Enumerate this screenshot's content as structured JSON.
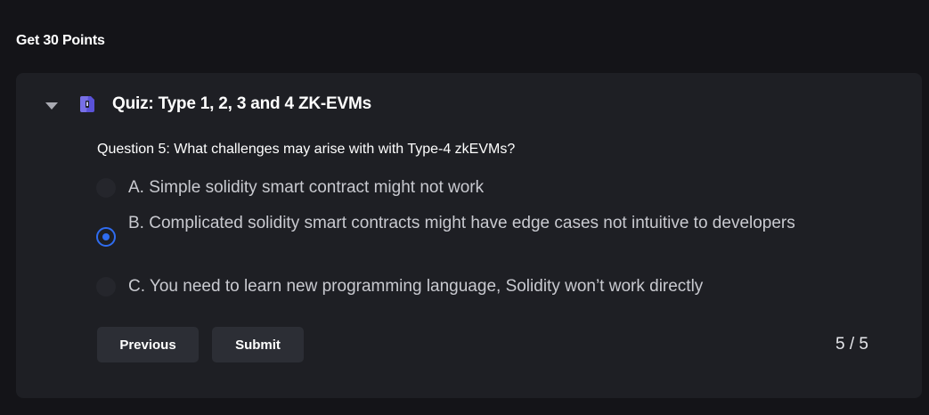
{
  "section": {
    "title": "Get 30 Points"
  },
  "quiz": {
    "icon": "quiz-badge-icon",
    "title": "Quiz: Type 1, 2, 3 and 4 ZK-EVMs",
    "expanded": true,
    "question": "Question 5: What challenges may arise with with Type-4 zkEVMs?",
    "options": [
      {
        "label": "A. Simple solidity smart contract might not work",
        "selected": false
      },
      {
        "label": "B. Complicated solidity smart contracts might have edge cases not intuitive to developers",
        "selected": true
      },
      {
        "label": "C. You need to learn new programming language, Solidity won’t work directly",
        "selected": false
      }
    ],
    "previous_label": "Previous",
    "submit_label": "Submit",
    "progress": "5 / 5"
  },
  "colors": {
    "page_bg": "#141418",
    "card_bg": "#1e1f24",
    "accent": "#2f6cf0",
    "button_bg": "#2c2e35"
  }
}
